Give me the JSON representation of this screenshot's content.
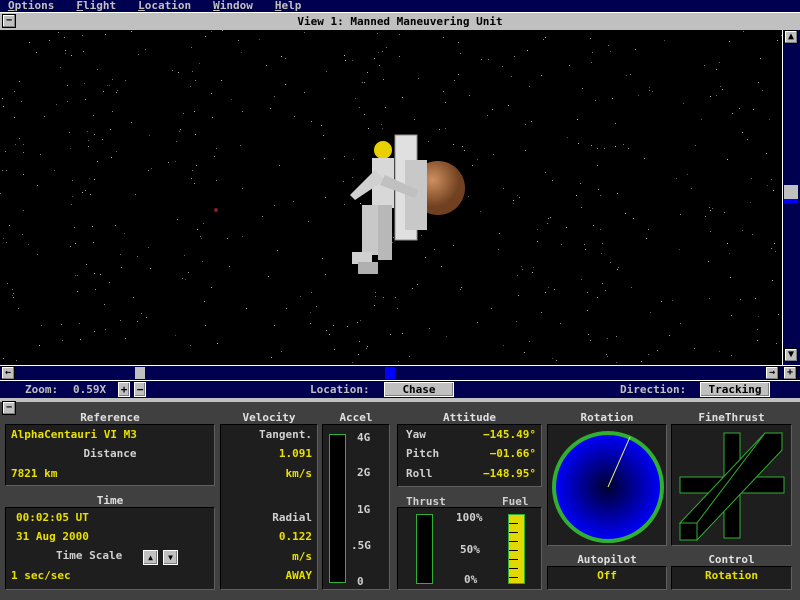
{
  "menu": [
    "Options",
    "Flight",
    "Location",
    "Window",
    "Help"
  ],
  "window_title": "View 1: Manned Maneuvering Unit",
  "toolbar": {
    "zoom_label": "Zoom:",
    "zoom_value": "0.59X",
    "zoom_in": "+",
    "zoom_out": "−",
    "location_label": "Location:",
    "location_value": "Chase",
    "direction_label": "Direction:",
    "direction_value": "Tracking"
  },
  "reference": {
    "title": "Reference",
    "body": "AlphaCentauri VI M3",
    "distance_label": "Distance",
    "distance": "7821 km"
  },
  "time": {
    "title": "Time",
    "clock": "00:02:05 UT",
    "date": "31 Aug 2000",
    "scale_label": "Time Scale",
    "scale": "1 sec/sec"
  },
  "velocity": {
    "title": "Velocity",
    "tangent_label": "Tangent.",
    "tangent": "1.091",
    "tangent_unit": "km/s",
    "radial_label": "Radial",
    "radial": "0.122",
    "radial_unit": "m/s",
    "radial_dir": "AWAY"
  },
  "accel": {
    "title": "Accel",
    "ticks": [
      "4G",
      "2G",
      "1G",
      ".5G",
      "0"
    ],
    "level": 0
  },
  "attitude": {
    "title": "Attitude",
    "yaw_label": "Yaw",
    "yaw": "−145.49°",
    "pitch_label": "Pitch",
    "pitch": "−01.66°",
    "roll_label": "Roll",
    "roll": "−148.95°"
  },
  "thrust": {
    "title": "Thrust",
    "fuel_title": "Fuel",
    "ticks": [
      "100%",
      "50%",
      "0%"
    ],
    "thrust_level": 0,
    "fuel_level": 100
  },
  "rotation": {
    "title": "Rotation"
  },
  "finethrust": {
    "title": "FineThrust"
  },
  "autopilot": {
    "title": "Autopilot",
    "value": "Off"
  },
  "control": {
    "title": "Control",
    "value": "Rotation"
  },
  "colors": {
    "panel": "#404040",
    "navy": "#000050",
    "readout": "#e8e000",
    "frame": "#30b030",
    "dial": "#0000ff"
  }
}
